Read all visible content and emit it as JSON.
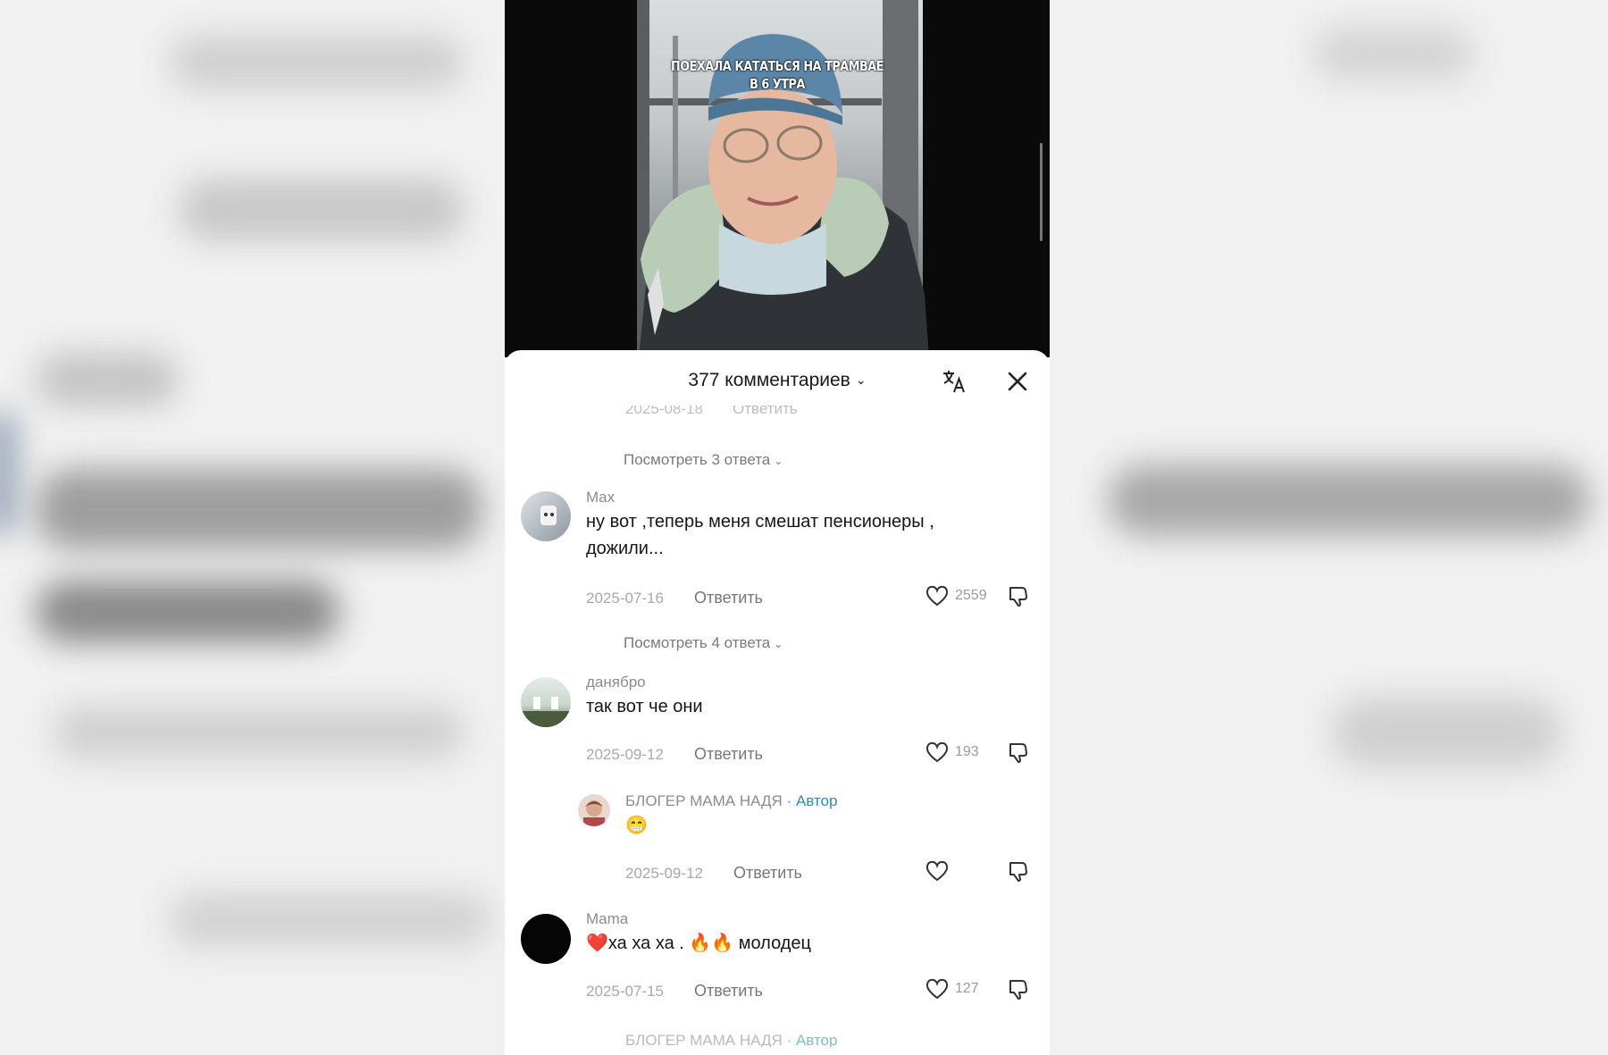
{
  "video": {
    "overlay_line1": "ПОЕХАЛА КАТАТЬСЯ НА ТРАМВАЕ",
    "overlay_line2": "В 6 УТРА"
  },
  "comments_sheet": {
    "count_label": "377 комментариев",
    "faded_date": "2025-08-18",
    "faded_reply": "Ответить",
    "replies_link_1": "Посмотреть 3 ответа",
    "replies_link_2": "Посмотреть 4 ответа",
    "comments": [
      {
        "name": "Max",
        "text_line1": "ну вот ,теперь меня смешат пенсионеры ,",
        "text_line2": "дожили...",
        "date": "2025-07-16",
        "reply": "Ответить",
        "likes": "2559"
      },
      {
        "name": "данябро",
        "text": "так вот че они",
        "date": "2025-09-12",
        "reply": "Ответить",
        "likes": "193"
      },
      {
        "name": "БЛОГЕР МАМА НАДЯ",
        "author_tag": "· Автор",
        "text": "😁",
        "date": "2025-09-12",
        "reply": "Ответить"
      },
      {
        "name": "Mama",
        "text": "❤️ха ха ха . 🔥🔥 молодец",
        "date": "2025-07-15",
        "reply": "Ответить",
        "likes": "127"
      }
    ],
    "cut_off_name": "БЛОГЕР МАМА НАДЯ",
    "cut_off_tag": "· Автор"
  },
  "icons": {
    "translate": "translate-icon",
    "close": "close-icon",
    "like": "heart-icon",
    "dislike": "dislike-icon"
  },
  "colors": {
    "author_accent": "#2a8fb0",
    "muted_text": "#8c8c8c"
  }
}
